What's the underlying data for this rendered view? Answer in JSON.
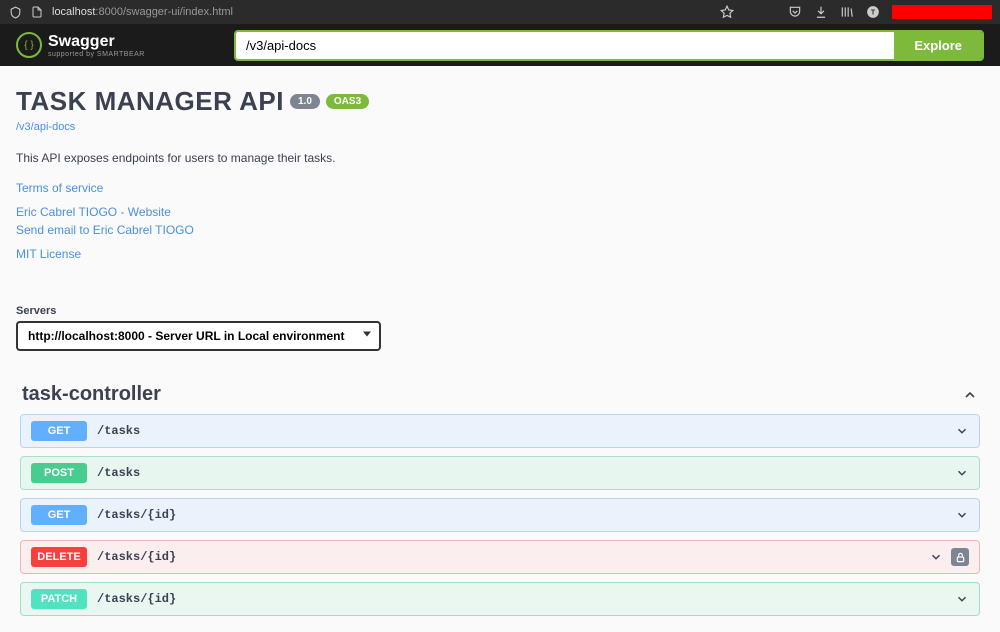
{
  "browser": {
    "url_host": "localhost",
    "url_port": ":8000",
    "url_path": "/swagger-ui/index.html"
  },
  "header": {
    "logo_text": "Swagger",
    "logo_sub": "supported by SMARTBEAR",
    "search_value": "/v3/api-docs",
    "explore_label": "Explore"
  },
  "api": {
    "title": "TASK MANAGER API",
    "version": "1.0",
    "oas": "OAS3",
    "docs_link": "/v3/api-docs",
    "description": "This API exposes endpoints for users to manage their tasks.",
    "links": {
      "tos": "Terms of service",
      "author": "Eric Cabrel TIOGO - Website",
      "email": "Send email to Eric Cabrel TIOGO",
      "license": "MIT License"
    }
  },
  "servers": {
    "label": "Servers",
    "selected": "http://localhost:8000 - Server URL in Local environment"
  },
  "controller": {
    "name": "task-controller",
    "endpoints": [
      {
        "method": "GET",
        "path": "/tasks",
        "theme": "get",
        "lock": false
      },
      {
        "method": "POST",
        "path": "/tasks",
        "theme": "post",
        "lock": false
      },
      {
        "method": "GET",
        "path": "/tasks/{id}",
        "theme": "get",
        "lock": false
      },
      {
        "method": "DELETE",
        "path": "/tasks/{id}",
        "theme": "delete",
        "lock": true
      },
      {
        "method": "PATCH",
        "path": "/tasks/{id}",
        "theme": "patch",
        "lock": false
      }
    ]
  }
}
